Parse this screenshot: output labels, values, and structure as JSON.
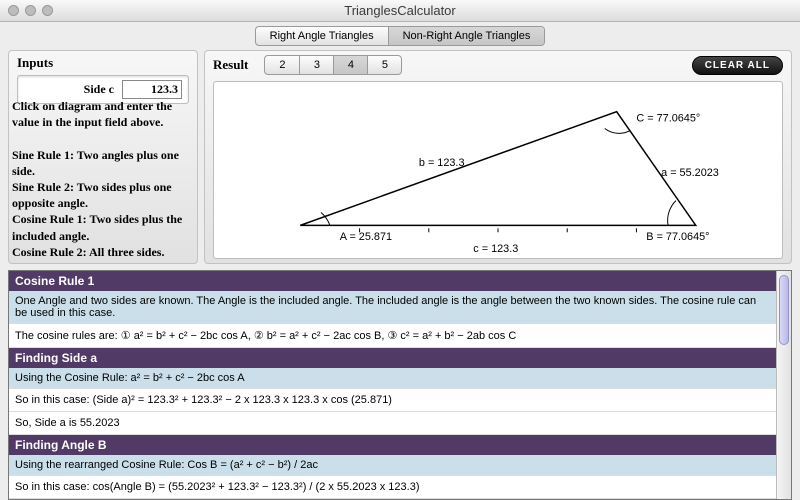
{
  "window": {
    "title": "TrianglesCalculator"
  },
  "tabs": {
    "items": [
      "Right Angle Triangles",
      "Non-Right Angle Triangles"
    ],
    "active": 1
  },
  "inputs_panel": {
    "title": "Inputs",
    "field_label": "Side c",
    "field_value": "123.3"
  },
  "instructions": {
    "intro": "Click on diagram and enter the value in the input field above.",
    "rule1": "Sine Rule 1: Two angles plus one side.",
    "rule2": "Sine Rule 2: Two sides plus one opposite angle.",
    "rule3": "Cosine Rule 1: Two sides plus the included angle.",
    "rule4": "Cosine Rule 2: All three sides."
  },
  "result_panel": {
    "title": "Result",
    "dp_options": [
      "2",
      "3",
      "4",
      "5"
    ],
    "dp_active": 2,
    "clear_label": "CLEAR ALL"
  },
  "triangle": {
    "A_label": "A = 25.871",
    "B_label": "B = 77.0645°",
    "C_label": "C = 77.0645°",
    "a_label": "a = 55.2023",
    "b_label": "b = 123.3",
    "c_label": "c = 123.3",
    "values": {
      "A": 25.871,
      "B": 77.0645,
      "C": 77.0645,
      "a": 55.2023,
      "b": 123.3,
      "c": 123.3
    }
  },
  "output": {
    "sec1_title": "Cosine Rule 1",
    "sec1_p1": "One Angle and two sides are known.  The Angle is the included angle. The included angle is the angle between the two known sides.  The cosine rule can be used in this case.",
    "sec1_p2": "The cosine rules are: ① a² = b² + c² − 2bc cos A, ② b² = a² + c² − 2ac cos B, ③ c² = a² + b² − 2ab cos C",
    "sec2_title": "Finding Side a",
    "sec2_p1": "Using the Cosine Rule: a² = b² + c² − 2bc cos A",
    "sec2_p2": "So in this case: (Side a)² = 123.3² + 123.3² − 2 x 123.3 x 123.3 x cos (25.871)",
    "sec2_p3": "So, Side a is 55.2023",
    "sec3_title": "Finding Angle B",
    "sec3_p1": "Using the rearranged Cosine Rule: Cos B = (a² + c² − b²) / 2ac",
    "sec3_p2": "So in this case: cos(Angle B) = (55.2023² + 123.3² − 123.3²) / (2 x 55.2023 x 123.3)"
  }
}
